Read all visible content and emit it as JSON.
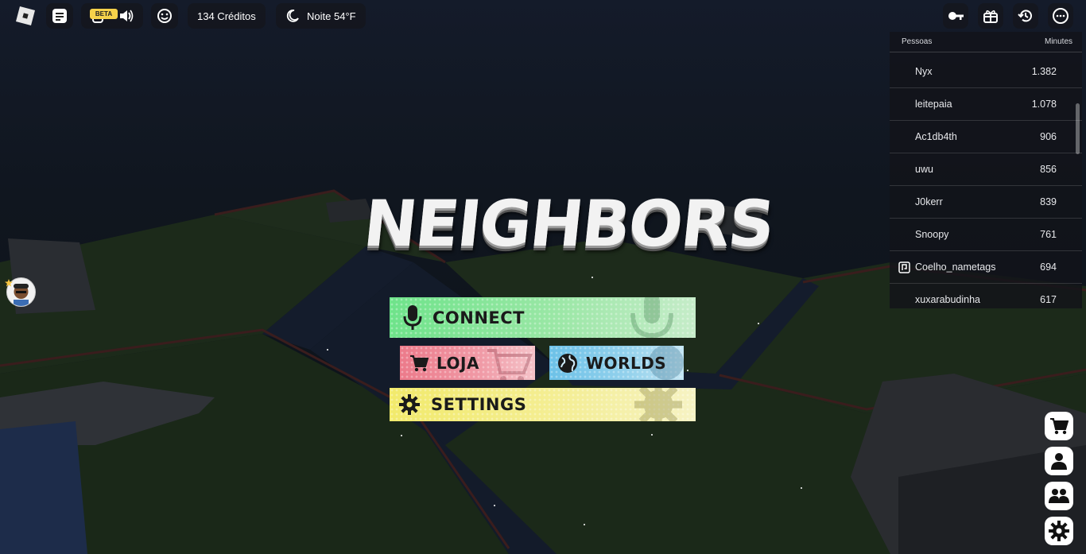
{
  "topbar": {
    "credits": "134 Créditos",
    "weather": "Noite 54°F",
    "beta_badge": "BETA"
  },
  "leaderboard": {
    "col_people": "Pessoas",
    "col_minutes": "Minutes",
    "rows": [
      {
        "name": "Nyx",
        "minutes": "1.382"
      },
      {
        "name": "leitepaia",
        "minutes": "1.078"
      },
      {
        "name": "Ac1db4th",
        "minutes": "906"
      },
      {
        "name": "uwu",
        "minutes": "856"
      },
      {
        "name": "J0kerr",
        "minutes": "839"
      },
      {
        "name": "Snoopy",
        "minutes": "761"
      },
      {
        "name": "Coelho_nametags",
        "minutes": "694"
      },
      {
        "name": "xuxarabudinha",
        "minutes": "617"
      }
    ]
  },
  "game": {
    "title": "NEIGHBORS"
  },
  "menu": {
    "connect": "CONNECT",
    "shop": "LOJA",
    "worlds": "WORLDS",
    "settings": "SETTINGS"
  },
  "colors": {
    "connect": "#6ee38a",
    "shop": "#ec7a8a",
    "worlds": "#6cc1e8",
    "settings": "#f2ea6b"
  },
  "icons": [
    "roblox-logo-icon",
    "chat-icon",
    "voice-icon",
    "speaker-icon",
    "emote-icon",
    "moon-icon",
    "key-icon",
    "gift-icon",
    "history-icon",
    "more-icon",
    "cart-icon",
    "avatar-icon",
    "friends-icon",
    "gear-icon"
  ]
}
